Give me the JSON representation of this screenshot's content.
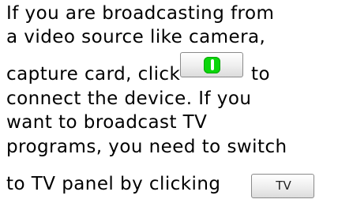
{
  "help_text": {
    "line1": "If you are broadcasting from",
    "line2": "a video source like camera,",
    "line3_before": "capture card, click",
    "line3_after": "to",
    "line4": "connect the device. If you",
    "line5": "want to broadcast TV",
    "line6": "programs, you need to switch",
    "line7": "to TV panel by clicking"
  },
  "connect_button": {
    "icon": "green-power-icon",
    "icon_color": "#0bd60b"
  },
  "tv_button": {
    "label": "TV"
  }
}
